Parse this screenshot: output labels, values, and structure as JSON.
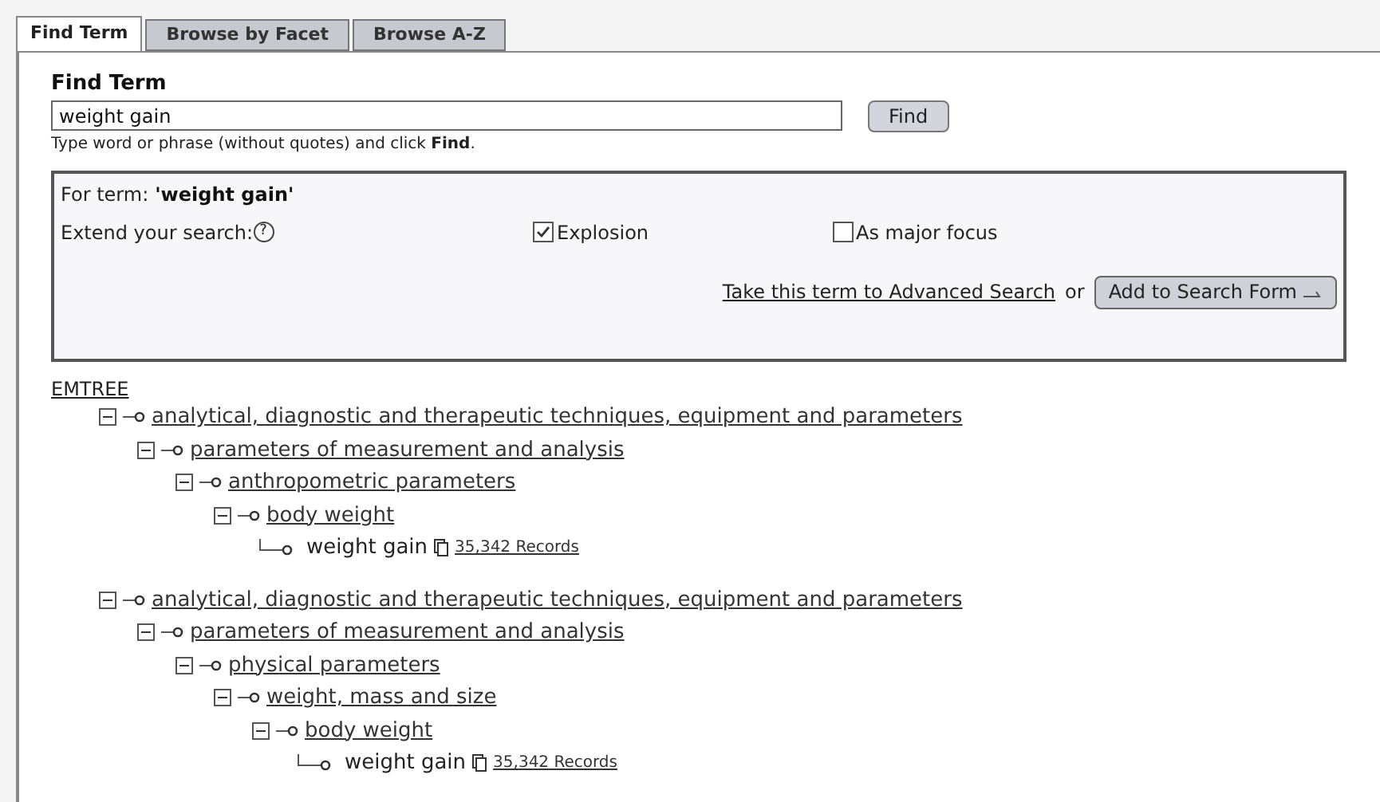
{
  "tabs": [
    {
      "label": "Find Term",
      "selected": true
    },
    {
      "label": "Browse by Facet",
      "selected": false
    },
    {
      "label": "Browse A-Z",
      "selected": false
    }
  ],
  "find": {
    "heading": "Find Term",
    "value": "weight gain",
    "button": "Find",
    "hint": "Type word or phrase (without quotes) and click **Find**."
  },
  "options": {
    "term_label": "For term:",
    "term": "'weight gain'",
    "extend_label": "Extend your search:",
    "help": "?",
    "checkboxes": [
      {
        "label": "Explosion",
        "checked": true
      },
      {
        "label": "As major focus",
        "checked": false
      }
    ],
    "link": "Take this term to Advanced Search",
    "or": "or",
    "button": "Add to Search Form"
  },
  "tree_root": "EMTREE",
  "trees": [
    {
      "label": "analytical, diagnostic and therapeutic techniques, equipment and parameters",
      "expanded": true,
      "children": [
        {
          "label": "parameters of measurement and analysis",
          "expanded": true,
          "children": [
            {
              "label": "anthropometric parameters",
              "expanded": true,
              "children": [
                {
                  "label": "body weight",
                  "expanded": true,
                  "children": [
                    {
                      "label": "weight gain",
                      "records": "35,342 Records"
                    }
                  ]
                }
              ]
            }
          ]
        }
      ]
    },
    {
      "label": "analytical, diagnostic and therapeutic techniques, equipment and parameters",
      "expanded": true,
      "children": [
        {
          "label": "parameters of measurement and analysis",
          "expanded": true,
          "children": [
            {
              "label": "physical parameters",
              "expanded": true,
              "children": [
                {
                  "label": "weight, mass and size",
                  "expanded": true,
                  "children": [
                    {
                      "label": "body weight",
                      "expanded": true,
                      "children": [
                        {
                          "label": "weight gain",
                          "records": "35,342 Records"
                        }
                      ]
                    }
                  ]
                }
              ]
            }
          ]
        }
      ]
    }
  ]
}
